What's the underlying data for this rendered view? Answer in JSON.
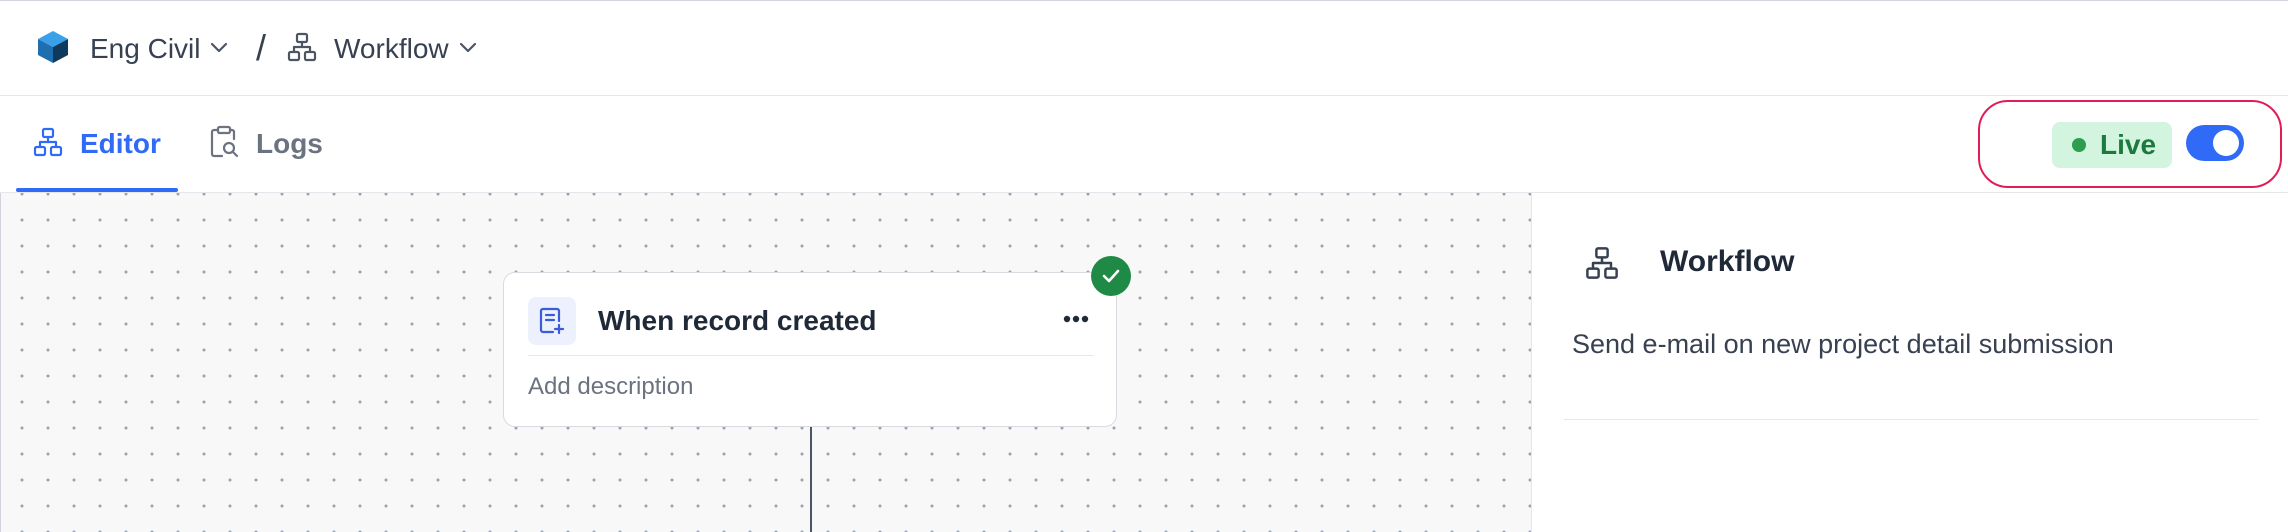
{
  "breadcrumb": {
    "workspace_label": "Eng Civil",
    "separator": "/",
    "section_label": "Workflow"
  },
  "tabs": [
    {
      "label": "Editor",
      "active": true
    },
    {
      "label": "Logs",
      "active": false
    }
  ],
  "status": {
    "badge_label": "Live",
    "toggle_on": true
  },
  "canvas": {
    "node": {
      "title": "When record created",
      "description_placeholder": "Add description",
      "status": "success"
    }
  },
  "panel": {
    "title": "Workflow",
    "description": "Send e-mail on new project detail submission"
  },
  "colors": {
    "accent": "#2f6bf6",
    "live_badge_bg": "#d3f4df",
    "live_text": "#1c7a3f",
    "success": "#1f8a46",
    "highlight_ring": "#e11d58"
  },
  "icons": {
    "workspace": "cube-logo-icon",
    "workflow": "workflow-hierarchy-icon",
    "logs": "clipboard-search-icon",
    "node": "document-add-icon",
    "node_menu": "more-horizontal-icon",
    "node_status": "check-icon",
    "dropdown": "chevron-down-icon"
  }
}
